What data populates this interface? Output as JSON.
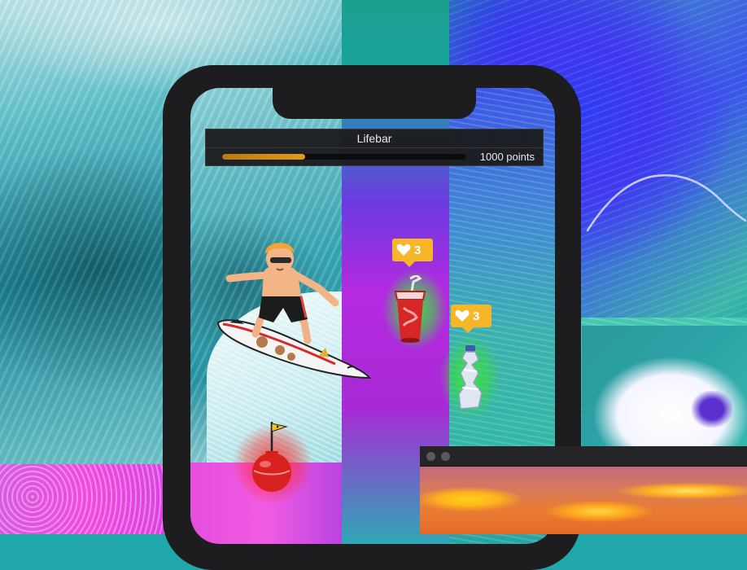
{
  "hud": {
    "title": "Lifebar",
    "points_label": "1000 points",
    "life_fraction": 0.34,
    "fill_color": "#e39a1a"
  },
  "items": [
    {
      "kind": "soda-cup",
      "likes": "3",
      "glow_color": "#3ce63c"
    },
    {
      "kind": "plastic-bottle",
      "likes": "3",
      "glow_color": "#3ce63c"
    }
  ],
  "hazard": {
    "kind": "buoy",
    "glow_color": "#ff2828"
  },
  "player": {
    "kind": "surfer"
  },
  "colors": {
    "badge": "#f6b628",
    "phone_frame": "#1d1d1f",
    "panel": "#1c1c1e"
  }
}
